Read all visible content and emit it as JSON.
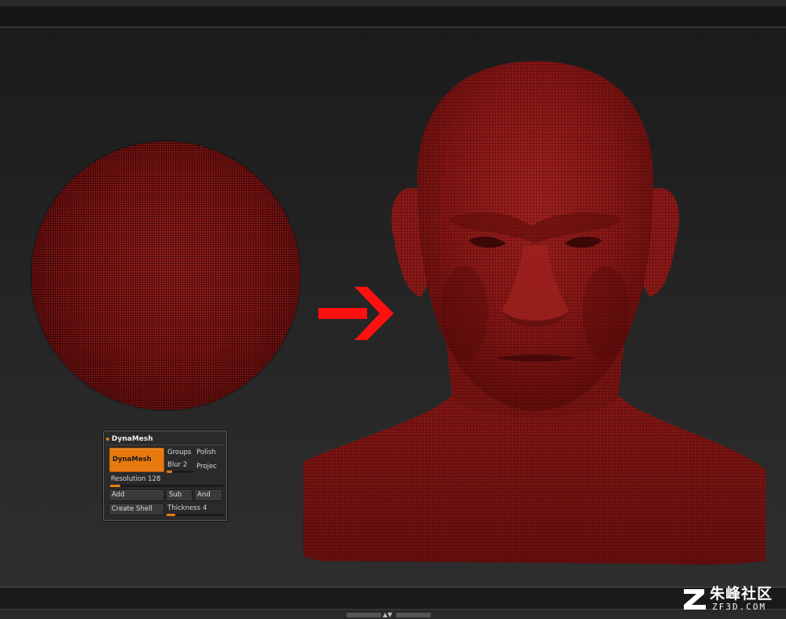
{
  "panel": {
    "title": "DynaMesh",
    "dynamesh_button": "DynaMesh",
    "groups_label": "Groups",
    "polish_label": "Polish",
    "blur_label": "Blur 2",
    "blur_level": 0.2,
    "project_label": "Projec",
    "resolution_label": "Resolution 128",
    "resolution_level": 0.09,
    "add_button": "Add",
    "sub_button": "Sub",
    "and_button": "And",
    "create_shell_button": "Create Shell",
    "thickness_label": "Thickness 4",
    "thickness_level": 0.15
  },
  "watermark": {
    "title": "朱峰社区",
    "subtitle": "ZF3D.COM"
  },
  "colors": {
    "accent": "#e8790f",
    "mesh_red": "#861614",
    "arrow_red": "#ff0000"
  },
  "icons": {
    "arrow": "right-arrow-icon",
    "logo": "zf3d-logo-icon",
    "collapse": "collapse-arrows-icon"
  }
}
